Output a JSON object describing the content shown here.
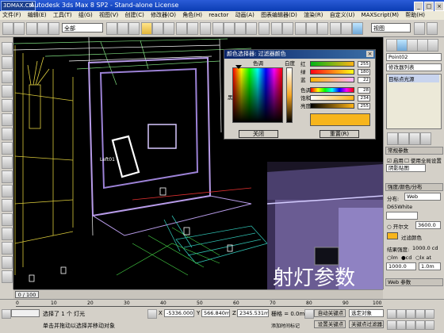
{
  "window": {
    "watermark": "3DMAX.CN",
    "title": "Autodesk 3ds Max 8 SP2 - Stand-alone License",
    "controls": [
      "_",
      "□",
      "×"
    ]
  },
  "menu": [
    "文件(F)",
    "编辑(E)",
    "工具(T)",
    "组(G)",
    "视图(V)",
    "创建(C)",
    "修改器(O)",
    "角色(H)",
    "reactor",
    "动画(A)",
    "图表编辑器(D)",
    "渲染(R)",
    "自定义(U)",
    "MAXScript(M)",
    "帮助(H)"
  ],
  "toolbar": {
    "select_filter": "全部",
    "view_select": "视图"
  },
  "viewport": {
    "light_label": "Left01",
    "caption": "射灯参数"
  },
  "color_dialog": {
    "title": "颜色选择器: 过滤器颜色",
    "hue_label": "色调",
    "white_label": "白度",
    "black_label": "黑",
    "labels": [
      "红",
      "绿",
      "蓝",
      "色调",
      "饱和度",
      "亮度"
    ],
    "values": [
      "255",
      "180",
      "22",
      "28",
      "234",
      "255"
    ],
    "close_button": "关闭",
    "reset_button": "重置(R)"
  },
  "right_panel": {
    "object_name": "Point02",
    "modifier_list": "修改器列表",
    "modifier_item": "目标点光源",
    "shadow_section": "常规参数",
    "shadow_on_label": "启用",
    "shadow_global_label": "使用全局设置",
    "shadow_type": "阴影贴图",
    "intensity_section": "强度/颜色/分布",
    "distribution_label": "分布:",
    "distribution_value": "Web",
    "color_label": "D65White",
    "kelvin_label": "开尔文",
    "kelvin_value": "3600.0",
    "filter_label": "过滤颜色",
    "result_label": "结果强度:",
    "result_value": "1000.0 cd",
    "units": [
      "lm",
      "cd",
      "lx at"
    ],
    "units_value": "1000.0",
    "units_dist": "1.0m",
    "web_section": "Web 参数"
  },
  "bottom": {
    "frame_counter": "0 / 100",
    "ticks": [
      "0",
      "10",
      "20",
      "30",
      "40",
      "50",
      "60",
      "70",
      "80",
      "90",
      "100"
    ],
    "selection_status": "选择了 1 个 灯光",
    "prompt": "单击并拖动以选择并移动对象",
    "x_label": "X",
    "x_value": "-5336.000",
    "y_label": "Y",
    "y_value": "566.840mm",
    "z_label": "Z",
    "z_value": "2345.531mm",
    "grid_label": "栅格 = 0.0mm",
    "auto_key": "自动关键点",
    "set_key": "设置关键点",
    "selected_option": "选定对象",
    "key_filters": "关键点过滤器...",
    "add_time_tag": "添加时间标记"
  }
}
